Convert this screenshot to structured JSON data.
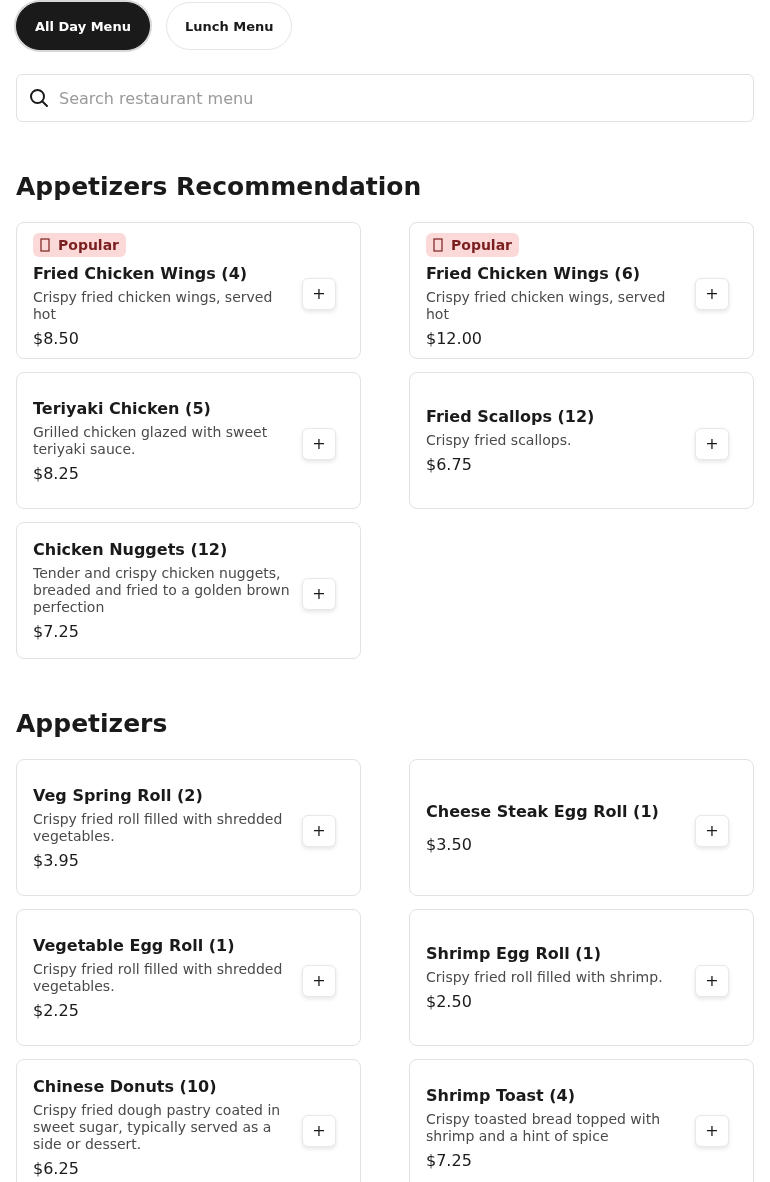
{
  "menu_tabs": [
    {
      "label": "All Day Menu",
      "selected": true
    },
    {
      "label": "Lunch Menu",
      "selected": false
    }
  ],
  "search": {
    "placeholder": "Search restaurant menu"
  },
  "sections": [
    {
      "title": "Appetizers Recommendation",
      "items": [
        {
          "name": "Fried Chicken Wings (4)",
          "popular": true,
          "badge": "Popular",
          "description": "Crispy fried chicken wings, served hot",
          "price": "$8.50",
          "add": "+"
        },
        {
          "name": "Fried Chicken Wings (6)",
          "popular": true,
          "badge": "Popular",
          "description": "Crispy fried chicken wings, served hot",
          "price": "$12.00",
          "add": "+"
        },
        {
          "name": "Teriyaki Chicken (5)",
          "popular": false,
          "description": "Grilled chicken glazed with sweet teriyaki sauce.",
          "price": "$8.25",
          "add": "+"
        },
        {
          "name": "Fried Scallops (12)",
          "popular": false,
          "description": "Crispy fried scallops.",
          "price": "$6.75",
          "add": "+"
        },
        {
          "name": "Chicken Nuggets (12)",
          "popular": false,
          "description": "Tender and crispy chicken nuggets, breaded and fried to a golden brown perfection",
          "price": "$7.25",
          "add": "+"
        }
      ]
    },
    {
      "title": "Appetizers",
      "items": [
        {
          "name": "Veg Spring Roll (2)",
          "popular": false,
          "description": "Crispy fried roll filled with shredded vegetables.",
          "price": "$3.95",
          "add": "+"
        },
        {
          "name": "Cheese Steak Egg Roll (1)",
          "popular": false,
          "price": "$3.50",
          "add": "+"
        },
        {
          "name": "Vegetable Egg Roll (1)",
          "popular": false,
          "description": "Crispy fried roll filled with shredded vegetables.",
          "price": "$2.25",
          "add": "+"
        },
        {
          "name": "Shrimp Egg Roll (1)",
          "popular": false,
          "description": "Crispy fried roll filled with shrimp.",
          "price": "$2.50",
          "add": "+"
        },
        {
          "name": "Chinese Donuts (10)",
          "popular": false,
          "description": "Crispy fried dough pastry coated in sweet sugar, typically served as a side or dessert.",
          "price": "$6.25",
          "add": "+"
        },
        {
          "name": "Shrimp Toast (4)",
          "popular": false,
          "description": "Crispy toasted bread topped with shrimp and a hint of spice",
          "price": "$7.25",
          "add": "+"
        }
      ]
    }
  ]
}
